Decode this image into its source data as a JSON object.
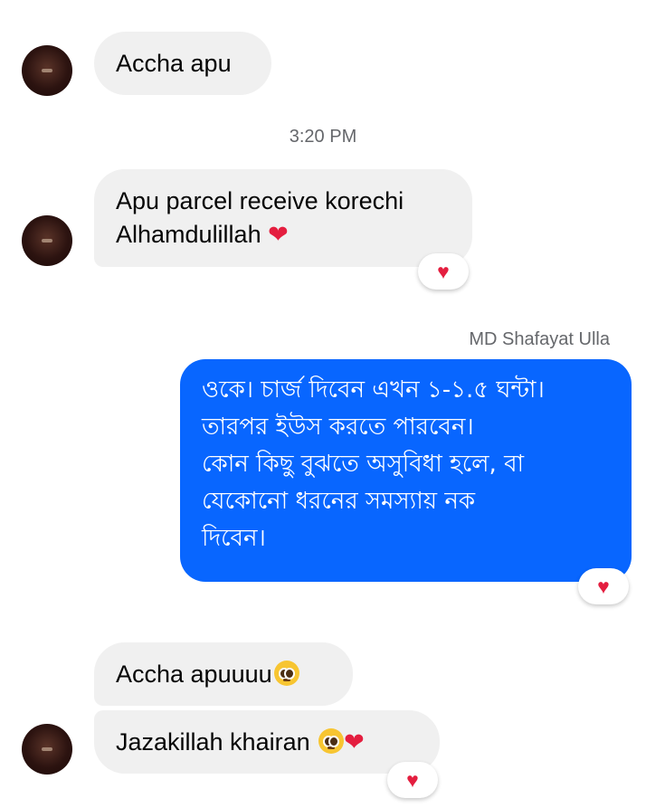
{
  "conversation": {
    "messages": [
      {
        "text": "Accha apu"
      },
      {
        "line1": "Apu parcel receive korechi",
        "line2": "Alhamdulillah",
        "emoji": "❤",
        "reaction": "♥"
      },
      {
        "lines": [
          "ওকে। চার্জ দিবেন এখন ১-১.৫ ঘন্টা।",
          "তারপর ইউস করতে পারবেন।",
          "কোন কিছু বুঝতে অসুবিধা হলে, বা",
          "যেকোনো ধরনের সমস্যায় নক",
          "দিবেন।"
        ],
        "reaction": "♥"
      },
      {
        "text": "Accha apuuuu",
        "emoji": "🥹"
      },
      {
        "text": "Jazakillah khairan",
        "emoji_face": "🥹",
        "emoji_heart": "❤",
        "reaction": "♥"
      }
    ],
    "timestamp": "3:20 PM",
    "sender_name": "MD Shafayat Ulla"
  },
  "colors": {
    "incoming_bubble": "#f0f0f0",
    "outgoing_bubble": "#0866ff",
    "reaction_heart": "#e41e3f",
    "meta_text": "#65676b"
  },
  "icons": {
    "avatar": "contact-avatar",
    "reaction": "heart-reaction-icon"
  }
}
